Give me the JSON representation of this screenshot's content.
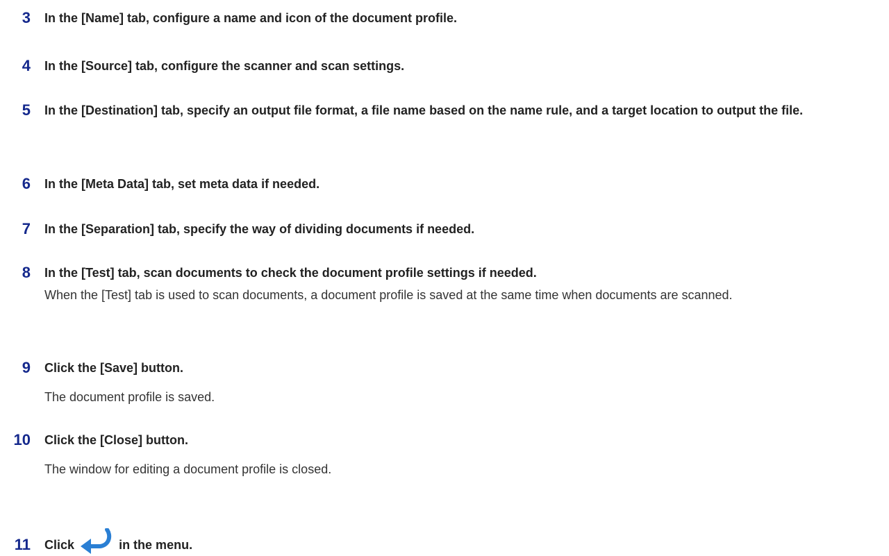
{
  "steps": [
    {
      "number": "3",
      "text": "In the [Name] tab, configure a name and icon of the document profile."
    },
    {
      "number": "4",
      "text": "In the [Source] tab, configure the scanner and scan settings."
    },
    {
      "number": "5",
      "text": "In the [Destination] tab, specify an output file format, a file name based on the name rule, and a target location to output the file."
    },
    {
      "number": "6",
      "text": "In the [Meta Data] tab, set meta data if needed."
    },
    {
      "number": "7",
      "text": "In the [Separation] tab, specify the way of dividing documents if needed."
    },
    {
      "number": "8",
      "text": "In the [Test] tab, scan documents to check the document profile settings if needed.",
      "description": "When the [Test] tab is used to scan documents, a document profile is saved at the same time when documents are scanned."
    },
    {
      "number": "9",
      "text": "Click the [Save] button.",
      "description": "The document profile is saved."
    },
    {
      "number": "10",
      "text": "Click the [Close] button.",
      "description": "The window for editing a document profile is closed."
    },
    {
      "number": "11",
      "text_before": "Click",
      "icon": "return-arrow-icon",
      "text_after": "in the menu."
    }
  ],
  "colors": {
    "step_number": "#14288c",
    "icon_blue": "#2a7fd4"
  }
}
